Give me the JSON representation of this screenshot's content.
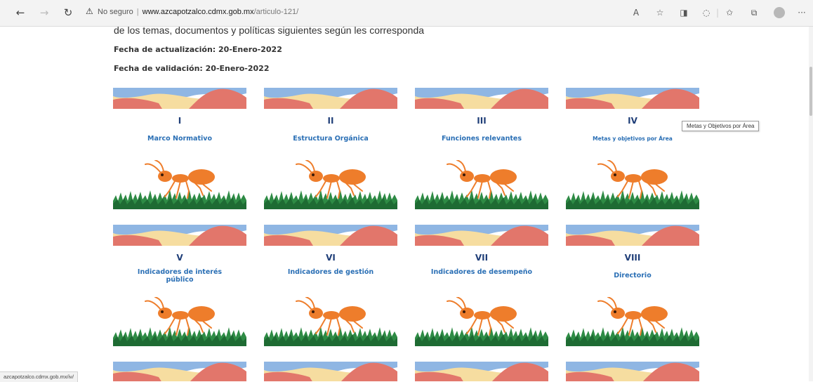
{
  "browser": {
    "back_icon": "←",
    "forward_icon": "→",
    "refresh_icon": "↻",
    "security_label": "No seguro",
    "url_host": "www.azcapotzalco.cdmx.gob.mx",
    "url_path": "/articulo-121/",
    "toolbar_icons": [
      "read-aloud-icon",
      "favorite-add-icon",
      "extension-icon",
      "refresh-circle-icon",
      "favorites-icon",
      "collections-icon",
      "profile-icon",
      "more-icon"
    ],
    "toolbar_glyphs": {
      "read_aloud": "A",
      "favorite_add": "☆",
      "extension": "◨",
      "circle": "◌",
      "favorites": "✩",
      "collections": "⧉",
      "more": "···"
    }
  },
  "page": {
    "intro_text": "de los temas, documentos y políticas siguientes según les corresponda",
    "update_date": "Fecha de actualización: 20-Enero-2022",
    "validation_date": "Fecha de validación: 20-Enero-2022",
    "cards": [
      {
        "roman": "I",
        "label": "Marco Normativo"
      },
      {
        "roman": "II",
        "label": "Estructura Orgánica"
      },
      {
        "roman": "III",
        "label": "Funciones relevantes"
      },
      {
        "roman": "IV",
        "label": "Metas y objetivos por Área"
      },
      {
        "roman": "V",
        "label": "Indicadores de interés público"
      },
      {
        "roman": "VI",
        "label": "Indicadores de gestión"
      },
      {
        "roman": "VII",
        "label": "Indicadores de desempeño"
      },
      {
        "roman": "VIII",
        "label": "Directorio"
      }
    ]
  },
  "tooltip": "Metas y Objetivos por Área",
  "status_url": "azcapotzalco.cdmx.gob.mx/iv/",
  "colors": {
    "sky": "#8fb6e3",
    "sand": "#f6dda0",
    "coral": "#e2766b",
    "ant": "#ee7d2b",
    "grass": "#2e8b45",
    "title_blue": "#2a6fb5"
  }
}
